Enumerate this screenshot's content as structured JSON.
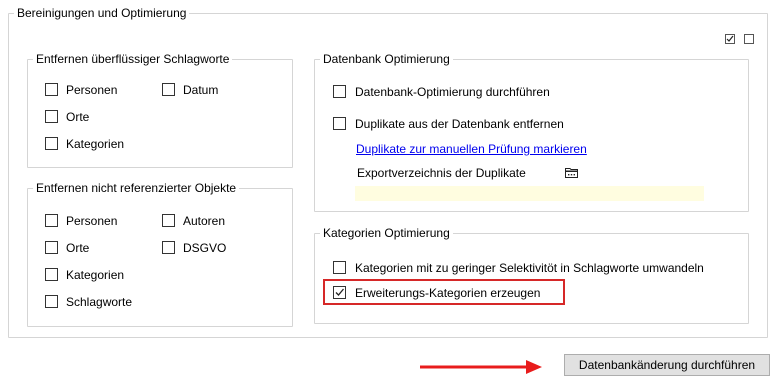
{
  "main_group": {
    "title": "Bereinigungen und Optimierung",
    "header_checks": [
      {
        "checked": true
      },
      {
        "checked": false
      }
    ]
  },
  "keywords_group": {
    "title": "Entfernen überflüssiger Schlagworte",
    "items": [
      {
        "label": "Personen",
        "checked": false
      },
      {
        "label": "Datum",
        "checked": false
      },
      {
        "label": "Orte",
        "checked": false
      },
      {
        "label": "Kategorien",
        "checked": false
      }
    ]
  },
  "unref_group": {
    "title": "Entfernen nicht referenzierter Objekte",
    "items": [
      {
        "label": "Personen",
        "checked": false
      },
      {
        "label": "Autoren",
        "checked": false
      },
      {
        "label": "Orte",
        "checked": false
      },
      {
        "label": "DSGVO",
        "checked": false
      },
      {
        "label": "Kategorien",
        "checked": false
      },
      {
        "label": "Schlagworte",
        "checked": false
      }
    ]
  },
  "db_group": {
    "title": "Datenbank Optimierung",
    "optimize_label": "Datenbank-Optimierung durchführen",
    "remove_duplicates_label": "Duplikate aus der Datenbank entfernen",
    "mark_duplicates_link": "Duplikate zur manuellen Prüfung markieren",
    "export_dir_label": "Exportverzeichnis der Duplikate",
    "folder_icon": "folder-icon",
    "export_dir_value": ""
  },
  "cat_group": {
    "title": "Kategorien Optimierung",
    "convert_label": "Kategorien mit zu geringer Selektivitöt in Schlagworte umwandeln",
    "extend_label": "Erweiterungs-Kategorien erzeugen",
    "extend_checked": true
  },
  "action": {
    "button_label": "Datenbankänderung durchführen"
  },
  "colors": {
    "highlight": "#d62828",
    "arrow": "#e81c1c",
    "link": "#0000ee"
  }
}
